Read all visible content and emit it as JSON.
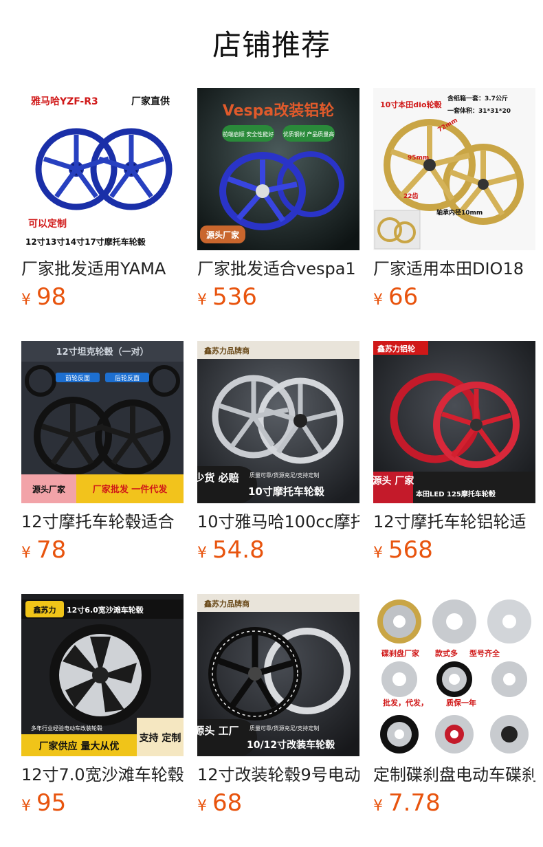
{
  "page": {
    "title": "店铺推荐"
  },
  "colors": {
    "price": "#e8540e",
    "title": "#111111",
    "text": "#222222"
  },
  "products": [
    {
      "name": "厂家批发适用YAMA",
      "currency": "¥",
      "price": "98",
      "image": {
        "icon": "blue-wheel-pair-image",
        "overlay": [
          "雅马哈YZF-R3",
          "厂家直供",
          "可以定制",
          "12寸13寸14寸17寸摩托车轮毂"
        ]
      }
    },
    {
      "name": "厂家批发适合vespa1",
      "currency": "¥",
      "price": "536",
      "image": {
        "icon": "vespa-blue-wheel-image",
        "overlay": [
          "Vespa改装铝轮",
          "前端启顺 安全性能好",
          "优质钢材 产品质量高",
          "源头厂家"
        ]
      }
    },
    {
      "name": "厂家适用本田DIO18",
      "currency": "¥",
      "price": "66",
      "image": {
        "icon": "gold-wheel-pair-image",
        "overlay": [
          "10寸本田dio轮毂",
          "含纸箱一套：3.7公斤",
          "一套体积：31*31*20",
          "72mm",
          "95mm",
          "22齿",
          "轴承内径10mm"
        ]
      }
    },
    {
      "name": "12寸摩托车轮毂适合",
      "currency": "¥",
      "price": "78",
      "image": {
        "icon": "black-tank-wheel-image",
        "overlay": [
          "12寸坦克轮毂（一对）",
          "前轮反面",
          "后轮反面",
          "源头厂家",
          "厂家批发 一件代发"
        ]
      }
    },
    {
      "name": "10寸雅马哈100cc摩托",
      "currency": "¥",
      "price": "54.8",
      "image": {
        "icon": "silver-wheel-pair-image",
        "overlay": [
          "鑫苏力品牌商",
          "少货 必赔",
          "质量可靠/货源充足/支持定制",
          "10寸摩托车轮毂"
        ]
      }
    },
    {
      "name": "12寸摩托车轮铝轮适",
      "currency": "¥",
      "price": "568",
      "image": {
        "icon": "red-wheel-pair-image",
        "overlay": [
          "鑫苏力铝轮",
          "源头 厂家",
          "本田LED 125摩托车轮毂"
        ]
      }
    },
    {
      "name": "12寸7.0宽沙滩车轮毂",
      "currency": "¥",
      "price": "95",
      "image": {
        "icon": "atv-wheel-image",
        "overlay": [
          "鑫苏力",
          "12寸6.0宽沙滩车轮毂",
          "多年行业经验电动车改装轮毂",
          "厂家供应 量大从优",
          "支持 定制"
        ]
      }
    },
    {
      "name": "12寸改装轮毂9号电动",
      "currency": "¥",
      "price": "68",
      "image": {
        "icon": "black-silver-wheel-image",
        "overlay": [
          "鑫苏力品牌商",
          "源头 工厂",
          "质量可靠/货源充足/支持定制",
          "10/12寸改装车轮毂"
        ]
      }
    },
    {
      "name": "定制碟刹盘电动车碟刹",
      "currency": "¥",
      "price": "7.78",
      "image": {
        "icon": "brake-disc-grid-image",
        "overlay": [
          "碟刹盘厂家",
          "款式多",
          "型号齐全",
          "批发，代发，",
          "质保一年"
        ]
      }
    }
  ]
}
